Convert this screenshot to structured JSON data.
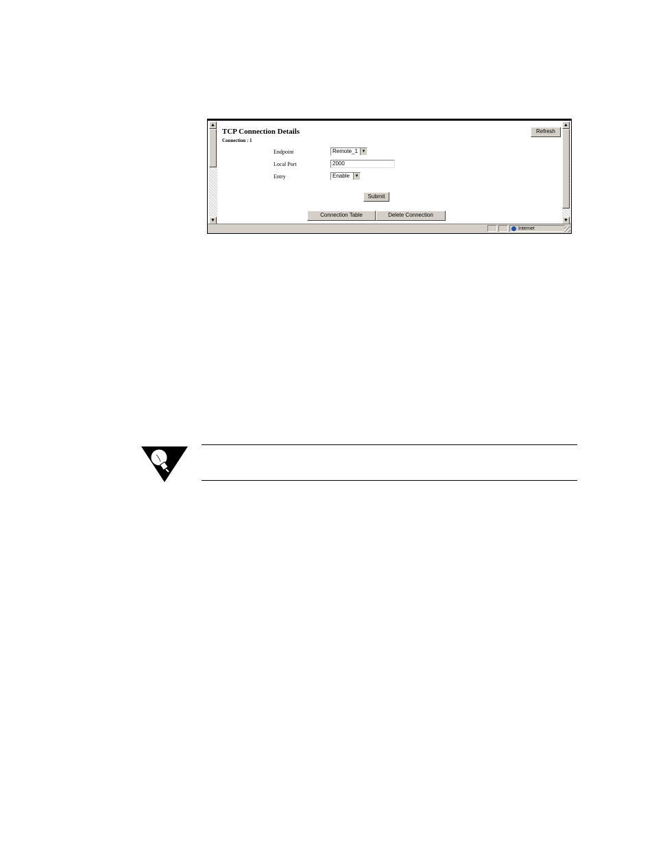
{
  "browser": {
    "page_title": "TCP Connection Details",
    "connection_label": "Connection : 1",
    "refresh_label": "Refresh",
    "fields": {
      "endpoint_label": "Endpoint",
      "endpoint_value": "Remote_1",
      "local_port_label": "Local Port",
      "local_port_value": "2000",
      "entry_label": "Entry",
      "entry_value": "Enable"
    },
    "submit_label": "Submit",
    "connection_table_label": "Connection Table",
    "delete_connection_label": "Delete Connection",
    "scroll_up_glyph": "▲",
    "scroll_down_glyph": "▼",
    "dropdown_glyph": "▼",
    "status_zone": "Internet"
  },
  "icons": {
    "tip": "lightbulb-tip-icon",
    "zone": "internet-globe-icon"
  }
}
